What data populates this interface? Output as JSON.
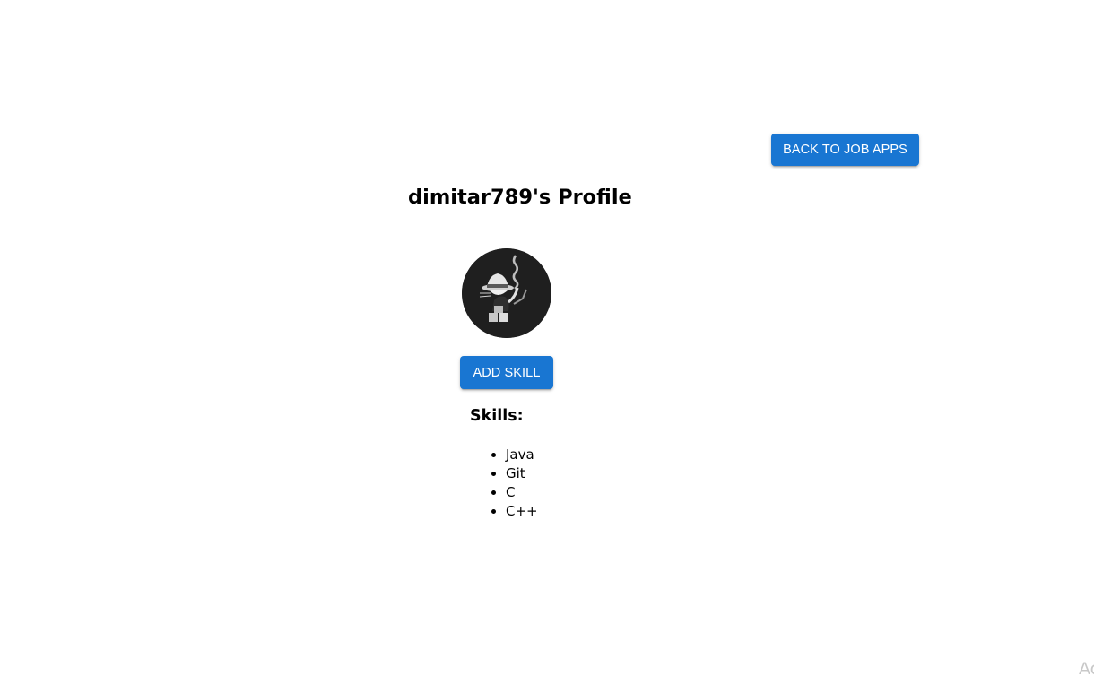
{
  "header": {
    "back_button_label": "BACK TO JOB APPS"
  },
  "profile": {
    "title": "dimitar789's Profile",
    "add_skill_label": "ADD SKILL",
    "skills_heading": "Skills:",
    "skills": [
      "Java",
      "Git",
      "C",
      "C++"
    ]
  },
  "corner_text": "Ac",
  "colors": {
    "button_bg": "#1976d2",
    "button_text": "#ffffff",
    "avatar_bg": "#1f1f1f"
  }
}
